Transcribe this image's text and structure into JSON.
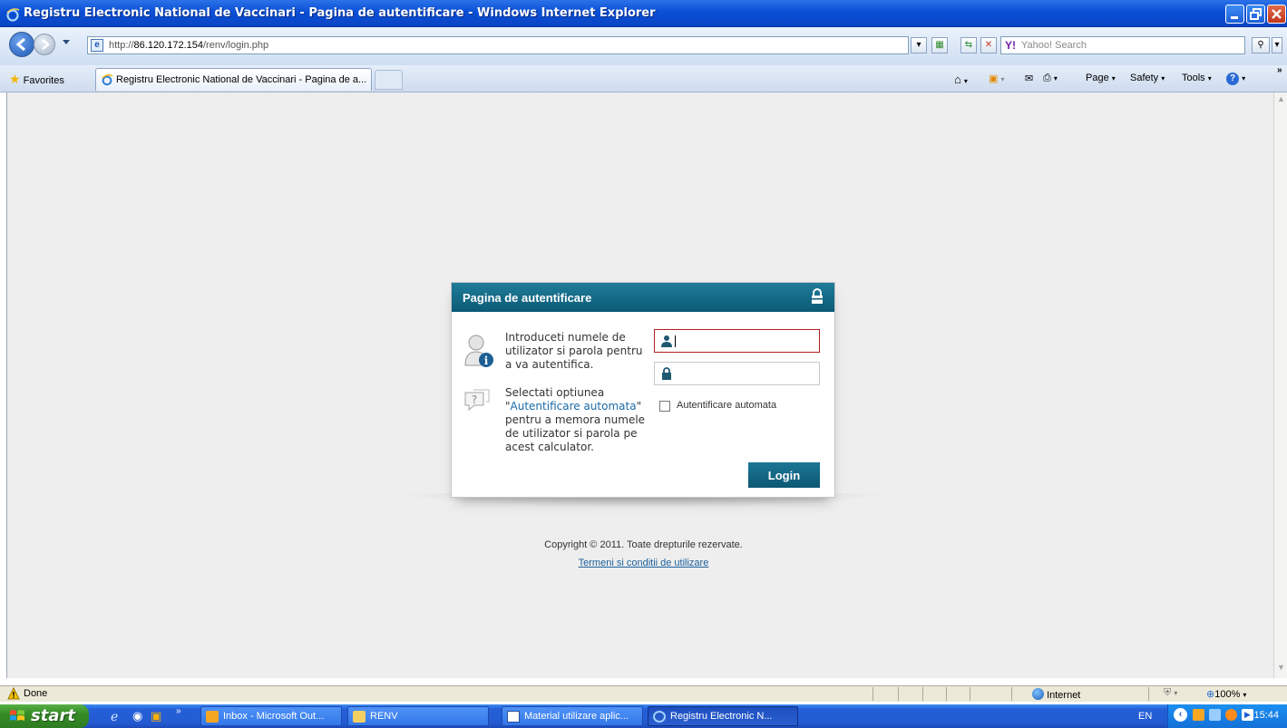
{
  "window": {
    "title": "Registru Electronic National de Vaccinari - Pagina de autentificare - Windows Internet Explorer"
  },
  "address": {
    "url_prefix": "http://",
    "url_host": "86.120.172.154",
    "url_path": "/renv/login.php",
    "search_placeholder": "Yahoo! Search"
  },
  "tabs": {
    "favorites_label": "Favorites",
    "active_tab_label": "Registru Electronic National de Vaccinari - Pagina de a...",
    "page_menu": "Page",
    "safety_menu": "Safety",
    "tools_menu": "Tools"
  },
  "login": {
    "header": "Pagina de autentificare",
    "info_text": "Introduceti numele de utilizator si parola pentru a va autentifica.",
    "select_text_before": "Selectati optiunea \"",
    "select_link": "Autentificare automata",
    "select_text_after": "\" pentru a memora numele de utilizator si parola pe acest calculator.",
    "remember_label": "Autentificare automata",
    "remember_checked": false,
    "login_button": "Login"
  },
  "footer": {
    "copyright": "Copyright © 2011. Toate drepturile rezervate.",
    "terms_link": "Termeni si conditii de utilizare"
  },
  "statusbar": {
    "status": "Done",
    "zone": "Internet",
    "zoom": "100%"
  },
  "taskbar": {
    "start_label": "start",
    "buttons": [
      "Inbox - Microsoft Out...",
      "RENV",
      "Material utilizare aplic...",
      "Registru Electronic N..."
    ],
    "language": "EN",
    "clock": "15:44"
  },
  "colors": {
    "accent": "#0b5a76",
    "link": "#1a6aa8",
    "error_border": "#b22020"
  }
}
